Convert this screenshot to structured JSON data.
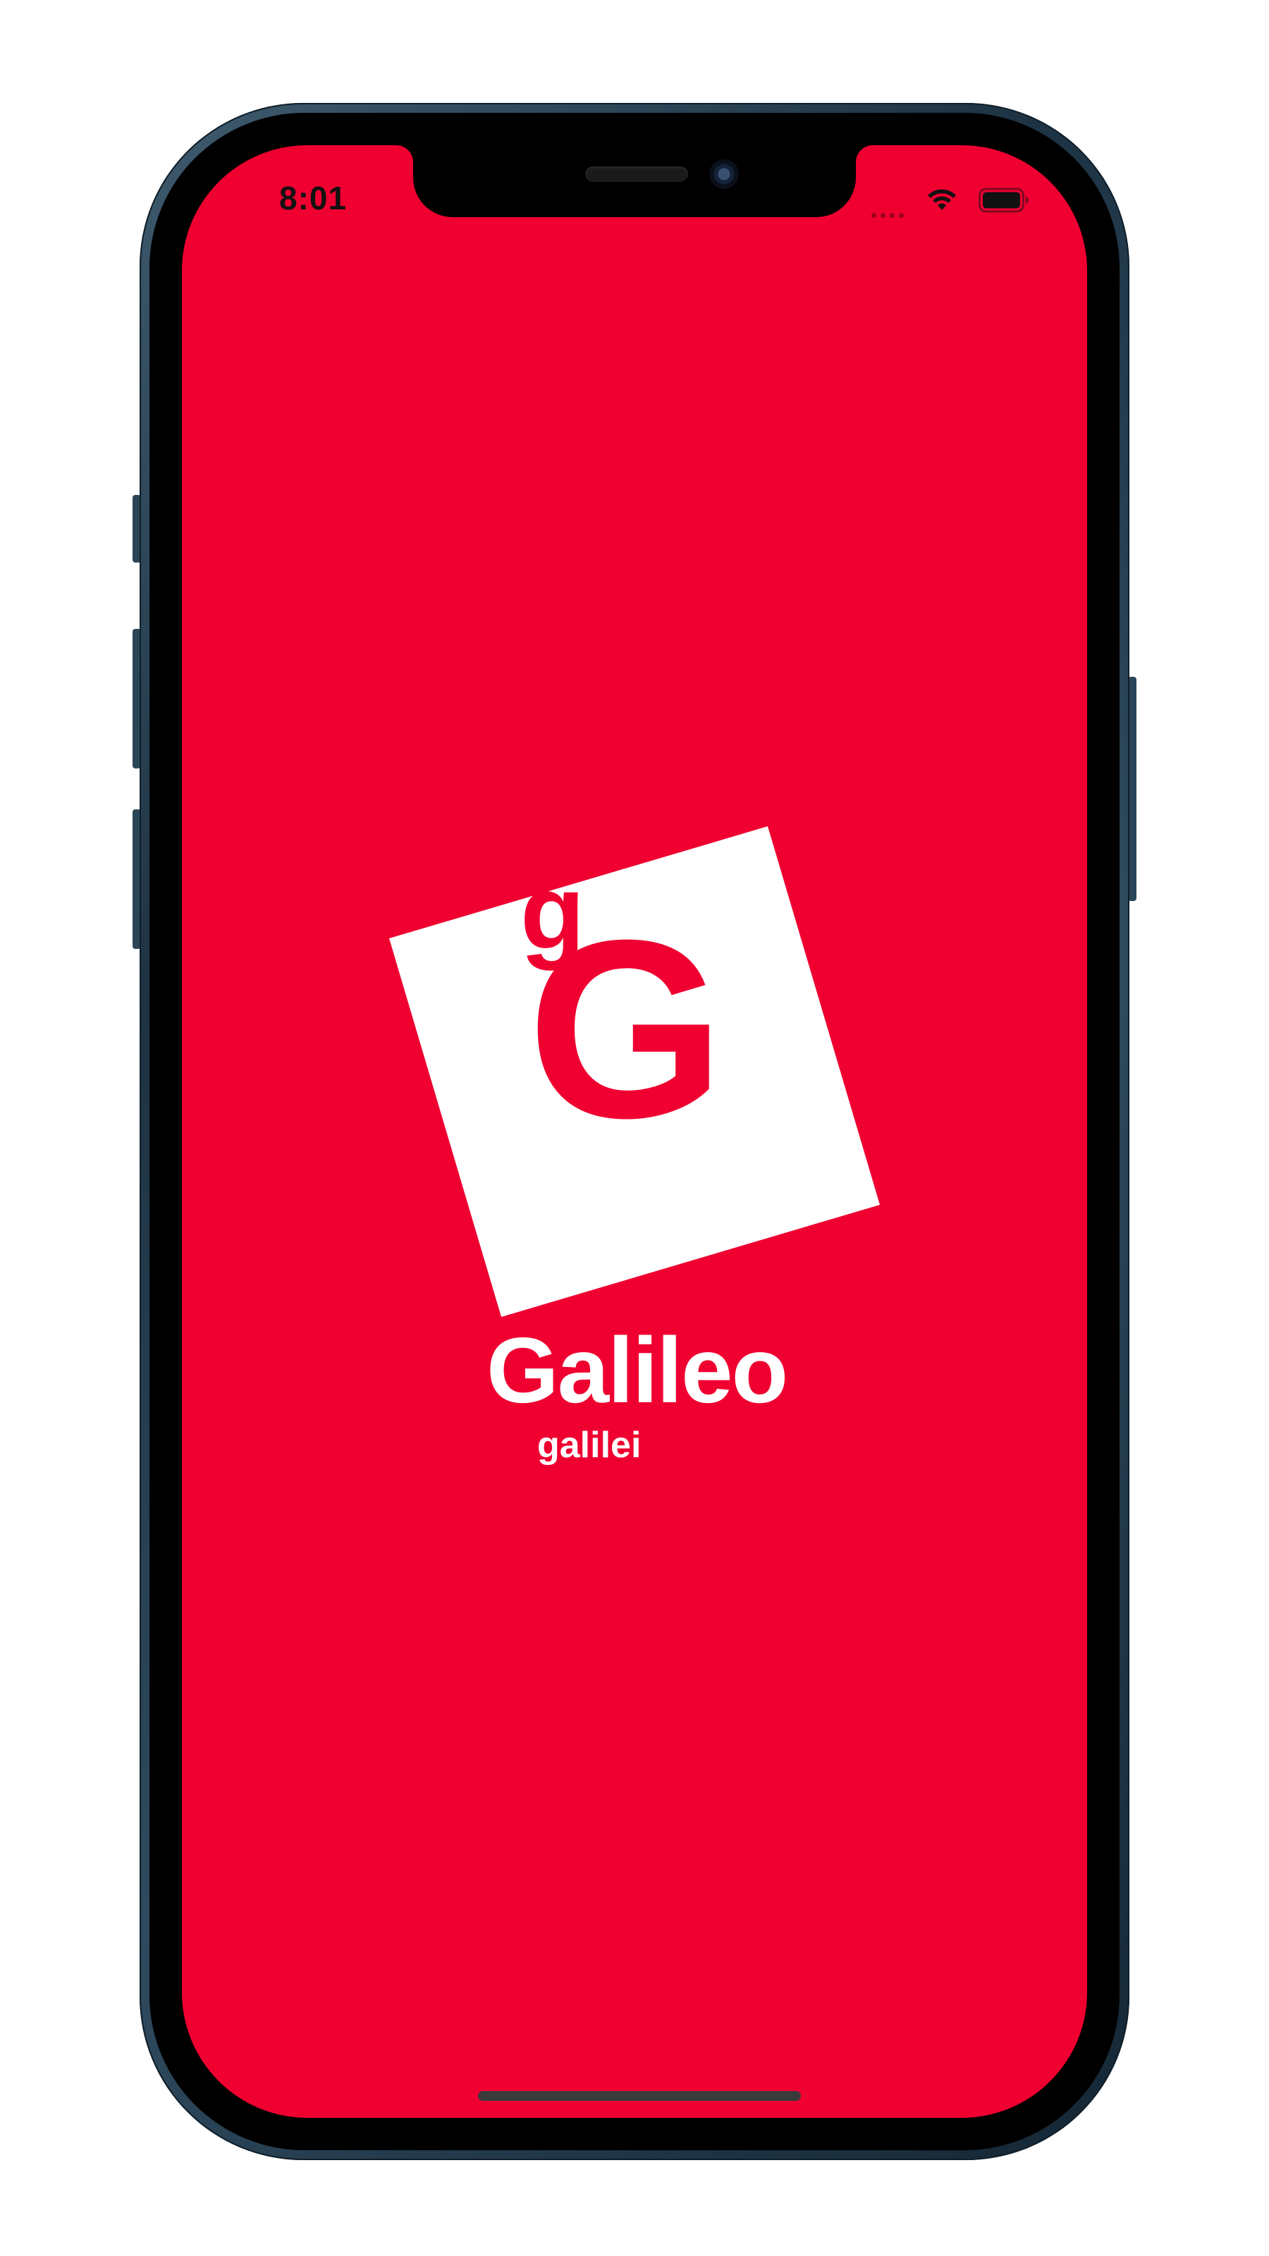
{
  "status_bar": {
    "time": "8:01",
    "icons": [
      "signal-dots-icon",
      "wifi-icon",
      "battery-icon"
    ]
  },
  "splash": {
    "logo_small_letter": "g",
    "logo_big_letter": "G",
    "brand_name": "Galileo",
    "brand_subtitle": "galilei"
  },
  "colors": {
    "background": "#ef0030",
    "logo_square": "#ffffff",
    "text": "#ffffff",
    "frame": "#1d3344"
  }
}
